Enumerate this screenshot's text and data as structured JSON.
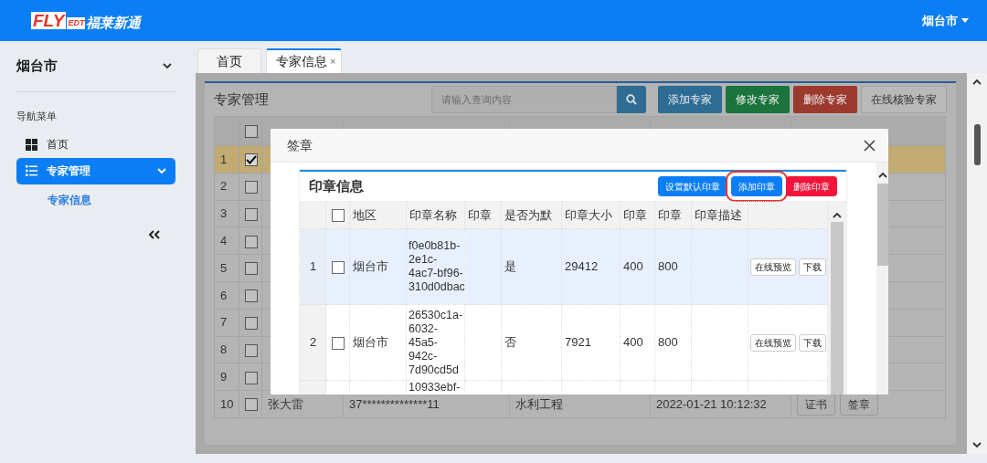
{
  "navbar": {
    "logo": {
      "mark": "FLY",
      "suffix": "EDT",
      "brand": "福莱新通"
    },
    "city": "烟台市"
  },
  "sidebar": {
    "region": "烟台市",
    "menu_heading": "导航菜单",
    "items": [
      {
        "label": "首页",
        "kind": "grid",
        "selected": false
      },
      {
        "label": "专家管理",
        "kind": "list",
        "selected": true,
        "expanded": true,
        "children": [
          {
            "label": "专家信息",
            "selected": true
          }
        ]
      }
    ]
  },
  "tabs": [
    {
      "label": "首页",
      "selected": false
    },
    {
      "label": "专家信息",
      "selected": true,
      "close": "×"
    }
  ],
  "expert_panel": {
    "title": "专家管理",
    "search": {
      "placeholder": "请输入查询内容"
    },
    "buttons": [
      {
        "label": "添加专家",
        "kind": "primary"
      },
      {
        "label": "修改专家",
        "kind": "success"
      },
      {
        "label": "删除专家",
        "kind": "danger"
      },
      {
        "label": "在线核验专家",
        "kind": "default"
      }
    ],
    "header_checked": false,
    "rows": [
      {
        "number": "1",
        "checked": true,
        "selected": true
      },
      {
        "number": "2",
        "checked": false,
        "selected": false
      },
      {
        "number": "3",
        "checked": false,
        "selected": false
      },
      {
        "number": "4",
        "checked": false,
        "selected": false
      },
      {
        "number": "5",
        "checked": false,
        "selected": false
      },
      {
        "number": "6",
        "checked": false,
        "selected": false
      },
      {
        "number": "7",
        "checked": false,
        "selected": false
      },
      {
        "number": "8",
        "checked": false,
        "selected": false
      },
      {
        "number": "9",
        "checked": false,
        "selected": false
      },
      {
        "number": "10",
        "checked": false,
        "selected": false,
        "name": "张大雷",
        "id_number": "37**************11",
        "industry": "水利工程",
        "issued": "2022-01-21 10:12:32",
        "actions": [
          "证书",
          "签章"
        ]
      }
    ]
  },
  "modal": {
    "title": "签章",
    "seal_panel": {
      "title": "印章信息",
      "buttons": [
        {
          "label": "设置默认印章",
          "kind": "primary",
          "highlighted": false
        },
        {
          "label": "添加印章",
          "kind": "primary",
          "highlighted": true
        },
        {
          "label": "删除印章",
          "kind": "danger",
          "highlighted": false
        }
      ],
      "header_checked": false,
      "columns": [
        "地区",
        "印章名称",
        "印章",
        "是否为默",
        "印章大小",
        "印章",
        "印章",
        "印章描述"
      ],
      "rows": [
        {
          "number": "1",
          "checked": false,
          "selected": true,
          "cells": [
            "烟台市",
            "f0e0b81b-2e1c-4ac7-bf96-310d0dbac",
            "",
            "是",
            "29412",
            "400",
            "800",
            ""
          ],
          "actions": [
            "在线预览",
            "下载"
          ]
        },
        {
          "number": "2",
          "checked": false,
          "selected": false,
          "cells": [
            "烟台市",
            "26530c1a-6032-45a5-942c-7d90cd5d",
            "",
            "否",
            "7921",
            "400",
            "800",
            ""
          ],
          "actions": [
            "在线预览",
            "下载"
          ]
        },
        {
          "cells": [
            "",
            "10933ebf-",
            "",
            "",
            "",
            "",
            "",
            ""
          ]
        }
      ]
    }
  }
}
